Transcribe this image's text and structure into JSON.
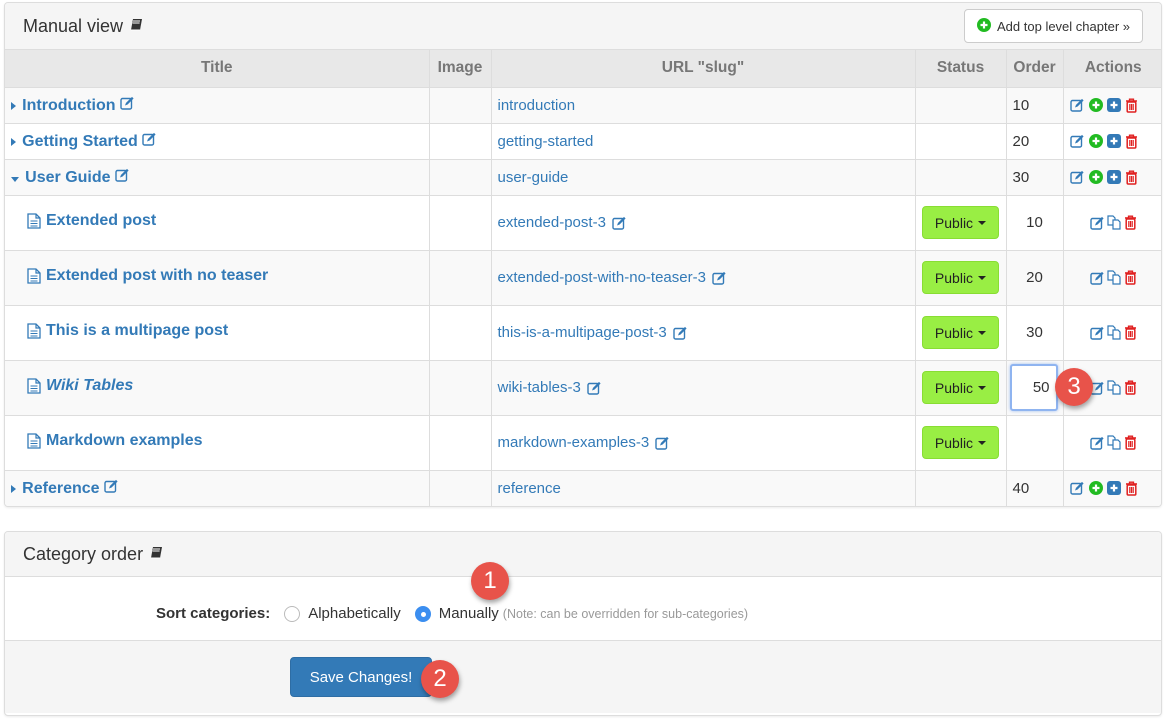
{
  "manual_panel": {
    "title": "Manual view",
    "title_icon": "book-icon",
    "add_button": {
      "label": "Add top level chapter »",
      "icon": "plus-circle-icon"
    }
  },
  "table": {
    "columns": [
      "Title",
      "Image",
      "URL \"slug\"",
      "Status",
      "Order",
      "Actions"
    ],
    "rows": [
      {
        "type": "chapter",
        "expanded": false,
        "title": "Introduction",
        "slug": "introduction",
        "order": "10",
        "actions": [
          "edit-icon",
          "add-child-icon",
          "add-sibling-icon",
          "delete-icon"
        ]
      },
      {
        "type": "chapter",
        "expanded": false,
        "title": "Getting Started",
        "slug": "getting-started",
        "order": "20",
        "actions": [
          "edit-icon",
          "add-child-icon",
          "add-sibling-icon",
          "delete-icon"
        ]
      },
      {
        "type": "chapter",
        "expanded": true,
        "title": "User Guide",
        "slug": "user-guide",
        "order": "30",
        "actions": [
          "edit-icon",
          "add-child-icon",
          "add-sibling-icon",
          "delete-icon"
        ]
      },
      {
        "type": "post",
        "title": "Extended post",
        "slug": "extended-post-3",
        "status": "Public",
        "order": "10",
        "actions": [
          "edit-icon",
          "copy-icon",
          "delete-icon"
        ]
      },
      {
        "type": "post",
        "title": "Extended post with no teaser",
        "slug": "extended-post-with-no-teaser-3",
        "status": "Public",
        "order": "20",
        "actions": [
          "edit-icon",
          "copy-icon",
          "delete-icon"
        ]
      },
      {
        "type": "post",
        "title": "This is a multipage post",
        "slug": "this-is-a-multipage-post-3",
        "status": "Public",
        "order": "30",
        "actions": [
          "edit-icon",
          "copy-icon",
          "delete-icon"
        ]
      },
      {
        "type": "post",
        "italic": true,
        "title": "Wiki Tables",
        "slug": "wiki-tables-3",
        "status": "Public",
        "order_input": "50",
        "actions": [
          "edit-icon",
          "copy-icon",
          "delete-icon"
        ]
      },
      {
        "type": "post",
        "title": "Markdown examples",
        "slug": "markdown-examples-3",
        "status": "Public",
        "order": "",
        "actions": [
          "edit-icon",
          "copy-icon",
          "delete-icon"
        ]
      },
      {
        "type": "chapter",
        "expanded": false,
        "title": "Reference",
        "slug": "reference",
        "order": "40",
        "actions": [
          "edit-icon",
          "add-child-icon",
          "add-sibling-icon",
          "delete-icon"
        ]
      }
    ]
  },
  "category_panel": {
    "title": "Category order",
    "title_icon": "book-icon",
    "sort_label": "Sort categories:",
    "options": [
      {
        "label": "Alphabetically",
        "checked": false
      },
      {
        "label": "Manually",
        "checked": true
      }
    ],
    "note": "(Note: can be overridden for sub-categories)",
    "save_label": "Save Changes!"
  },
  "annotations": [
    "1",
    "2",
    "3"
  ],
  "colors": {
    "link": "#337ab7",
    "status_public": "#99ee44",
    "add_green": "#22bb22",
    "delete_red": "#e02020",
    "badge": "#e8534a",
    "primary": "#337ab7"
  }
}
